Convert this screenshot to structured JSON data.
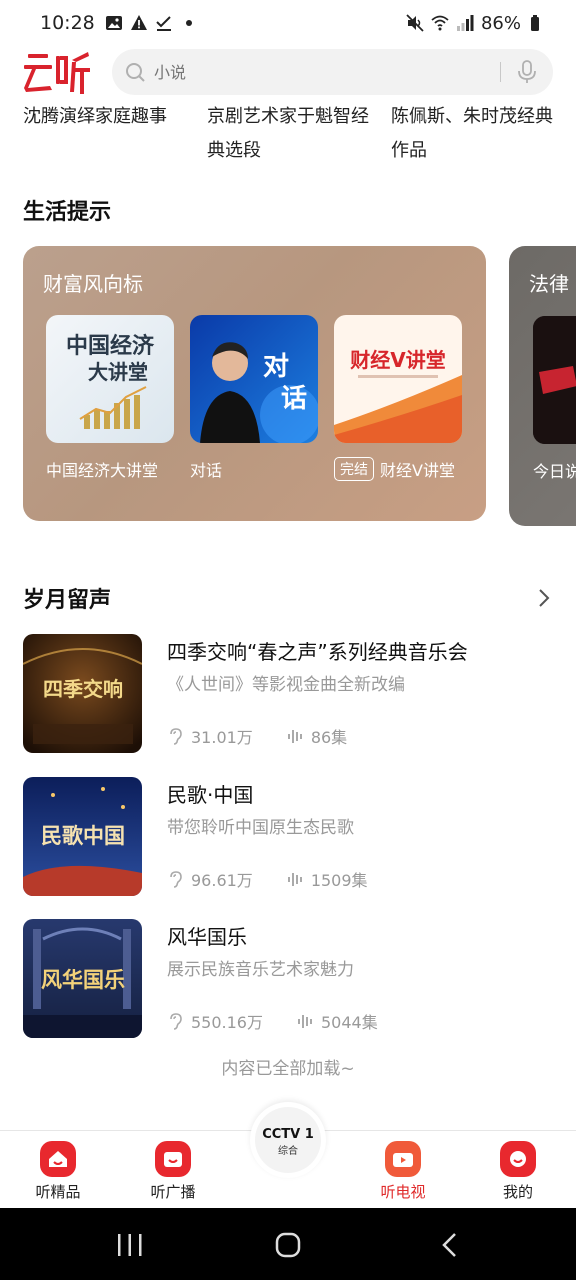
{
  "status_bar": {
    "time": "10:28",
    "battery": "86%"
  },
  "header": {
    "logo_text": "云听",
    "search_placeholder": "小说"
  },
  "top_row": [
    {
      "text": "沈腾演绎家庭趣事"
    },
    {
      "text": "京剧艺术家于魁智经典选段"
    },
    {
      "text": "陈佩斯、朱时茂经典作品"
    }
  ],
  "life_tips": {
    "section_title": "生活提示",
    "card": {
      "title": "财富风向标",
      "items": [
        {
          "label": "中国经济大讲堂",
          "thumb_text_1": "中国经济",
          "thumb_text_2": "大讲堂"
        },
        {
          "label": "对话",
          "thumb_text_1": "对",
          "thumb_text_2": "话"
        },
        {
          "label": "财经V讲堂",
          "badge": "完结",
          "thumb_text_1": "财经V讲堂"
        }
      ]
    },
    "card2": {
      "title": "法律",
      "item_label": "今日说"
    }
  },
  "years_section": {
    "title": "岁月留声",
    "items": [
      {
        "title": "四季交响“春之声”系列经典音乐会",
        "subtitle": "《人世间》等影视金曲全新改编",
        "plays": "31.01万",
        "episodes": "86集",
        "cover_text": "四季交响"
      },
      {
        "title": "民歌·中国",
        "subtitle": "带您聆听中国原生态民歌",
        "plays": "96.61万",
        "episodes": "1509集",
        "cover_text": "民歌中国"
      },
      {
        "title": "风华国乐",
        "subtitle": "展示民族音乐艺术家魅力",
        "plays": "550.16万",
        "episodes": "5044集",
        "cover_text": "风华国乐"
      }
    ],
    "footer": "内容已全部加载~"
  },
  "bottom_nav": {
    "tabs": [
      {
        "label": "听精品"
      },
      {
        "label": "听广播"
      },
      {
        "label": "听电视"
      },
      {
        "label": "我的"
      }
    ],
    "center_label": "CCTV 1",
    "center_sub": "综合"
  },
  "colors": {
    "accent": "#e02a2a",
    "card_bg": "#b89a85"
  }
}
